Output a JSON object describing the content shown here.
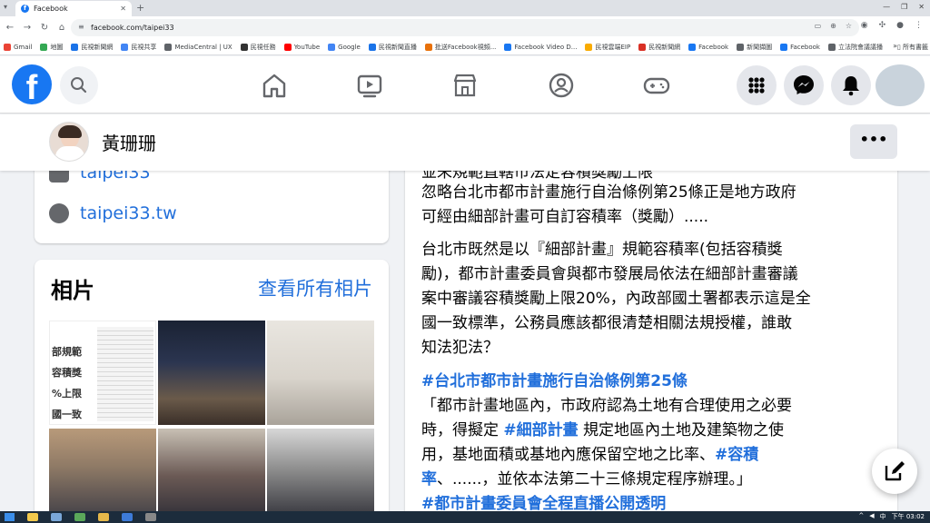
{
  "browser": {
    "tab_title": "Facebook",
    "url": "facebook.com/taipei33",
    "bookmarks": [
      {
        "label": "Gmail",
        "color": "#ea4335"
      },
      {
        "label": "地圖",
        "color": "#34a853"
      },
      {
        "label": "民視新聞網",
        "color": "#1a73e8"
      },
      {
        "label": "民視共享",
        "color": "#4285f4"
      },
      {
        "label": "MediaCentral | UX",
        "color": "#5f6368"
      },
      {
        "label": "民視任務",
        "color": "#333333"
      },
      {
        "label": "YouTube",
        "color": "#ff0000"
      },
      {
        "label": "Google",
        "color": "#4285f4"
      },
      {
        "label": "民視新聞直播",
        "color": "#1a73e8"
      },
      {
        "label": "批送Facebook視頻...",
        "color": "#e8710a"
      },
      {
        "label": "Facebook Video D...",
        "color": "#1877f2"
      },
      {
        "label": "民視雲端EIP",
        "color": "#f9ab00"
      },
      {
        "label": "民視新聞網",
        "color": "#d93025"
      },
      {
        "label": "Facebook",
        "color": "#1877f2"
      },
      {
        "label": "新聞擷圖",
        "color": "#5f6368"
      },
      {
        "label": "Facebook",
        "color": "#1877f2"
      },
      {
        "label": "立法院會議議播",
        "color": "#5f6368"
      }
    ],
    "bookmarks_more": "»",
    "all_bookmarks": "所有書籤"
  },
  "profile": {
    "name": "黃珊珊"
  },
  "links": {
    "instagram": "taipei33",
    "website": "taipei33.tw"
  },
  "photos": {
    "title": "相片",
    "see_all": "查看所有相片",
    "thumb1_lines": [
      "部規範",
      "容積獎",
      "%上限",
      "國一致"
    ]
  },
  "post": {
    "p0_partial": "並未規範直轄市法定容積獎勵上限",
    "p0_line2": "忽略台北市都市計畫施行自治條例第25條正是地方政府",
    "p0_line3": "可經由細部計畫可自訂容積率（獎勵）.....",
    "p1_line1": "台北市既然是以『細部計畫』規範容積率(包括容積獎",
    "p1_line2": "勵)，都市計畫委員會與都市發展局依法在細部計畫審議",
    "p1_line3": "案中審議容積獎勵上限20%，內政部國土署都表示這是全",
    "p1_line4": "國一致標準，公務員應該都很清楚相關法規授權，誰敢",
    "p1_line5": "知法犯法？",
    "hashtag1": "#台北市都市計畫施行自治條例第25條",
    "q_line1": "「都市計畫地區內，市政府認為土地有合理使用之必要",
    "q_line2_a": "時，得擬定 ",
    "q_line2_tag": "#細部計畫",
    "q_line2_b": " 規定地區內土地及建築物之使",
    "q_line3_a": "用，基地面積或基地內應保留空地之比率、",
    "q_line3_tag": "#容積",
    "q_line4_tag": "率",
    "q_line4_b": "、......，並依本法第二十三條規定程序辦理。」",
    "hashtag2": "#都市計畫委員會全程直播公開透明"
  },
  "taskbar": {
    "lang": "中",
    "time": "下午 03:02"
  },
  "colors": {
    "fb_blue": "#1877f2",
    "link_blue": "#216fdb",
    "bg": "#f0f2f5"
  }
}
